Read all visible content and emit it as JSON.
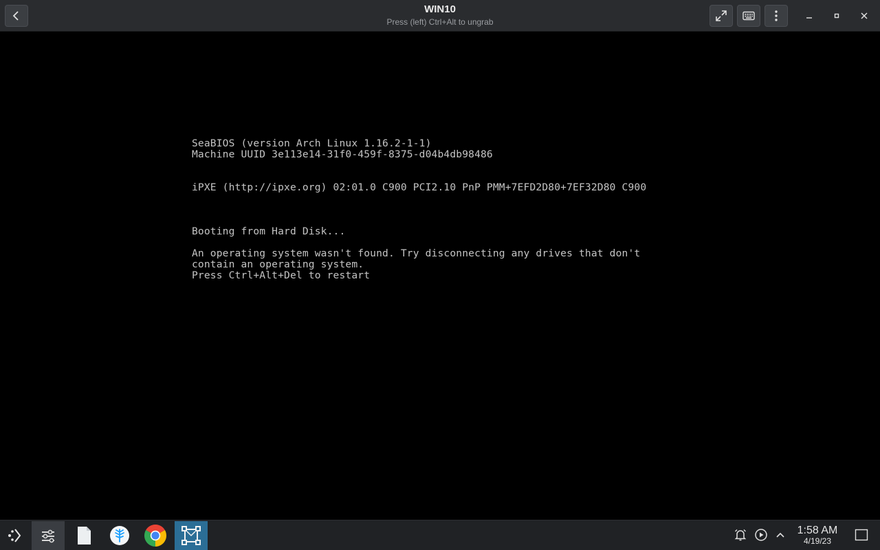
{
  "window": {
    "title": "WIN10",
    "subtitle": "Press (left) Ctrl+Alt to ungrab"
  },
  "toolbar": {
    "back_icon": "chevron-left-icon",
    "fullscreen_icon": "expand-arrows-icon",
    "keyboard_icon": "keyboard-icon",
    "menu_icon": "vertical-ellipsis-icon",
    "minimize_icon": "minimize-icon",
    "maximize_icon": "maximize-icon",
    "close_icon": "close-icon"
  },
  "console": {
    "lines": [
      "SeaBIOS (version Arch Linux 1.16.2-1-1)",
      "Machine UUID 3e113e14-31f0-459f-8375-d04b4db98486",
      "iPXE (http://ipxe.org) 02:01.0 C900 PCI2.10 PnP PMM+7EFD2D80+7EF32D80 C900",
      "Booting from Hard Disk...",
      "An operating system wasn't found. Try disconnecting any drives that don't",
      "contain an operating system.",
      "Press Ctrl+Alt+Del to restart"
    ],
    "text_color": "#c4c4c4",
    "background": "#000000"
  },
  "taskbar": {
    "items": [
      {
        "icon": "application-launcher-icon"
      },
      {
        "icon": "settings-sliders-icon"
      },
      {
        "icon": "file-icon"
      },
      {
        "icon": "steam-deck-icon"
      },
      {
        "icon": "chrome-icon"
      },
      {
        "icon": "virtual-machine-icon"
      }
    ],
    "tray": [
      "alarm-bell-icon",
      "media-play-icon",
      "chevron-up-icon"
    ],
    "clock": {
      "time": "1:58 AM",
      "date": "4/19/23"
    },
    "show_desktop_icon": "show-desktop-icon",
    "accent": "#2b6e96"
  }
}
